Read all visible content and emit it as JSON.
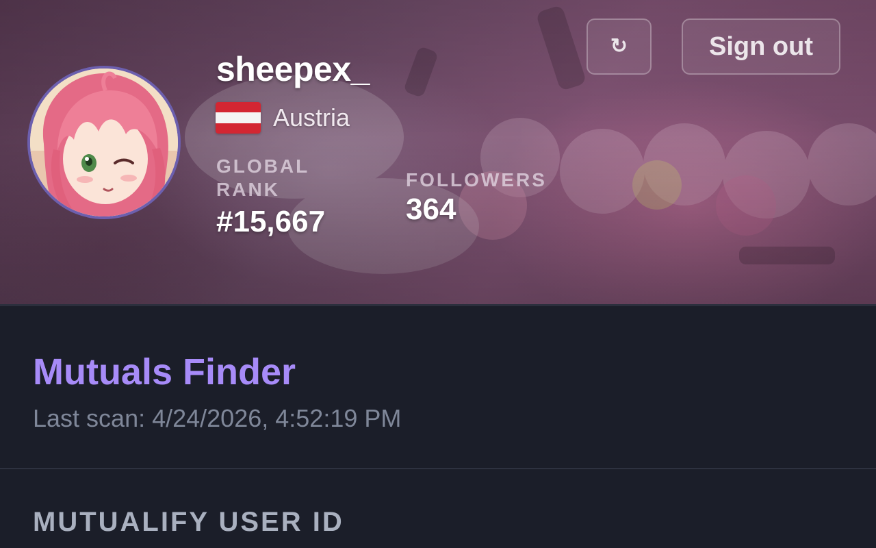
{
  "profile": {
    "username": "sheepex_",
    "country": "Austria",
    "flag_colors": {
      "top": "#d32632",
      "middle": "#f4f4f4",
      "bottom": "#d32632"
    },
    "global_rank_label": "GLOBAL RANK",
    "global_rank_value": "#15,667",
    "followers_label": "FOLLOWERS",
    "followers_value": "364",
    "avatar_icon": "anime-avatar-icon",
    "avatar_border_color": "#6c5fae"
  },
  "actions": {
    "refresh_icon": "↻",
    "sign_out_label": "Sign out"
  },
  "app": {
    "title": "Mutuals Finder",
    "last_scan": "Last scan: 4/24/2026, 4:52:19 PM",
    "accent_color": "#a78bf8"
  },
  "form": {
    "user_id_label": "MUTUALIFY USER ID"
  }
}
